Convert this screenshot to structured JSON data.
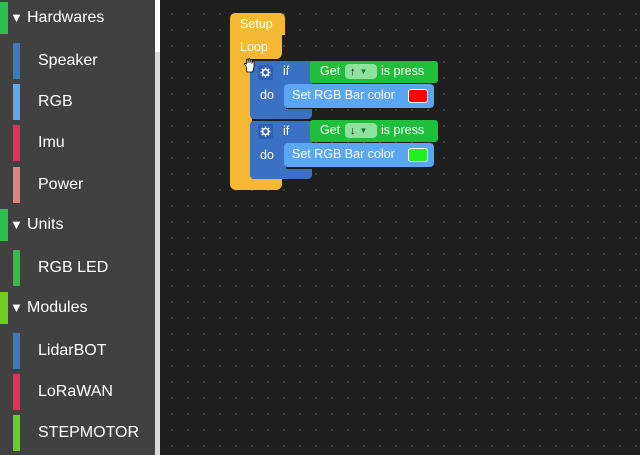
{
  "toolbox": {
    "categories": [
      {
        "label": "Hardwares",
        "color": "#2fbf4d",
        "items": [
          {
            "label": "Speaker",
            "color": "#3f79bf"
          },
          {
            "label": "RGB",
            "color": "#5aaaf2"
          },
          {
            "label": "Imu",
            "color": "#e0305c"
          },
          {
            "label": "Power",
            "color": "#e88080"
          }
        ]
      },
      {
        "label": "Units",
        "color": "#2fbf4d",
        "items": [
          {
            "label": "RGB LED",
            "color": "#2fbf4d"
          }
        ]
      },
      {
        "label": "Modules",
        "color": "#6fcc22",
        "items": [
          {
            "label": "LidarBOT",
            "color": "#3f79bf"
          },
          {
            "label": "LoRaWAN",
            "color": "#e0305c"
          },
          {
            "label": "STEPMOTOR",
            "color": "#6fcc22"
          }
        ]
      }
    ]
  },
  "workspace": {
    "setup_label": "Setup",
    "loop_label": "Loop",
    "if_blocks": [
      {
        "if_label": "if",
        "do_label": "do",
        "get_label": "Get",
        "arrow": "↑",
        "is_press_label": "is press",
        "set_label": "Set RGB Bar color",
        "color": "#ff0000"
      },
      {
        "if_label": "if",
        "do_label": "do",
        "get_label": "Get",
        "arrow": "↓",
        "is_press_label": "is press",
        "set_label": "Set RGB Bar color",
        "color": "#22ee22"
      }
    ]
  }
}
